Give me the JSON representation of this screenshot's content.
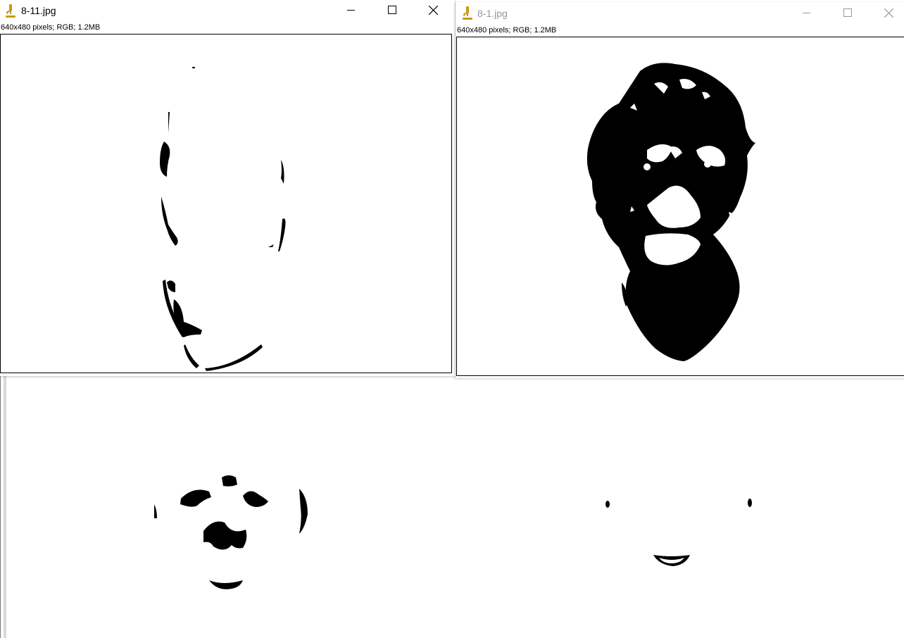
{
  "windows": [
    {
      "title": "8-11.jpg",
      "info": "640x480 pixels; RGB; 1.2MB",
      "state": "active",
      "icon": "microscope-icon",
      "controls": [
        "minimize-icon",
        "maximize-icon",
        "close-icon"
      ]
    },
    {
      "title": "8-1.jpg",
      "info": "640x480 pixels; RGB; 1.2MB",
      "state": "inactive",
      "icon": "microscope-icon",
      "controls": [
        "minimize-icon",
        "maximize-icon",
        "close-icon"
      ]
    }
  ],
  "colors": {
    "icon_gold": "#c89a1a",
    "inactive_title": "#999999",
    "border": "#000000"
  }
}
